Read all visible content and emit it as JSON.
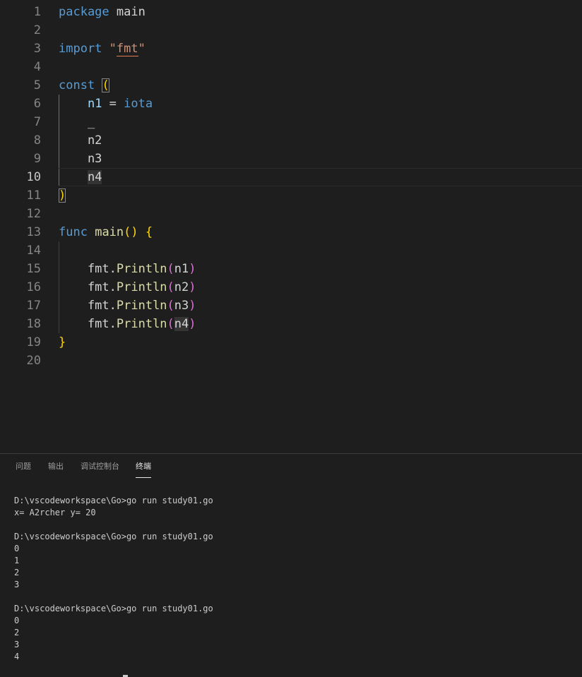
{
  "editor": {
    "lines": [
      {
        "n": "1",
        "tokens": [
          {
            "t": "package",
            "c": "kw"
          },
          {
            "t": " main",
            "c": "txt"
          }
        ]
      },
      {
        "n": "2",
        "tokens": []
      },
      {
        "n": "3",
        "tokens": [
          {
            "t": "import",
            "c": "kw"
          },
          {
            "t": " ",
            "c": "txt"
          },
          {
            "t": "\"",
            "c": "str"
          },
          {
            "t": "fmt",
            "c": "str",
            "squiggle": true
          },
          {
            "t": "\"",
            "c": "str"
          }
        ]
      },
      {
        "n": "4",
        "tokens": []
      },
      {
        "n": "5",
        "tokens": [
          {
            "t": "const",
            "c": "kw"
          },
          {
            "t": " ",
            "c": "txt"
          },
          {
            "t": "(",
            "c": "b1",
            "match": true
          }
        ]
      },
      {
        "n": "6",
        "tokens": [
          {
            "t": "    ",
            "c": "txt"
          },
          {
            "t": "n1",
            "c": "const"
          },
          {
            "t": " = ",
            "c": "txt"
          },
          {
            "t": "iota",
            "c": "kw"
          }
        ]
      },
      {
        "n": "7",
        "tokens": [
          {
            "t": "    _",
            "c": "txt"
          }
        ]
      },
      {
        "n": "8",
        "tokens": [
          {
            "t": "    n2",
            "c": "txt"
          }
        ]
      },
      {
        "n": "9",
        "tokens": [
          {
            "t": "    n3",
            "c": "txt"
          }
        ]
      },
      {
        "n": "10",
        "tokens": [
          {
            "t": "    ",
            "c": "txt"
          },
          {
            "t": "n4",
            "c": "txt",
            "hl": true
          }
        ],
        "current": true
      },
      {
        "n": "11",
        "tokens": [
          {
            "t": ")",
            "c": "b1",
            "match": true
          }
        ]
      },
      {
        "n": "12",
        "tokens": []
      },
      {
        "n": "13",
        "tokens": [
          {
            "t": "func",
            "c": "kw"
          },
          {
            "t": " ",
            "c": "txt"
          },
          {
            "t": "main",
            "c": "fn"
          },
          {
            "t": "()",
            "c": "b1"
          },
          {
            "t": " ",
            "c": "txt"
          },
          {
            "t": "{",
            "c": "b1"
          }
        ]
      },
      {
        "n": "14",
        "tokens": []
      },
      {
        "n": "15",
        "tokens": [
          {
            "t": "    fmt.",
            "c": "txt"
          },
          {
            "t": "Println",
            "c": "fn"
          },
          {
            "t": "(",
            "c": "b2"
          },
          {
            "t": "n1",
            "c": "txt"
          },
          {
            "t": ")",
            "c": "b2"
          }
        ]
      },
      {
        "n": "16",
        "tokens": [
          {
            "t": "    fmt.",
            "c": "txt"
          },
          {
            "t": "Println",
            "c": "fn"
          },
          {
            "t": "(",
            "c": "b2"
          },
          {
            "t": "n2",
            "c": "txt"
          },
          {
            "t": ")",
            "c": "b2"
          }
        ]
      },
      {
        "n": "17",
        "tokens": [
          {
            "t": "    fmt.",
            "c": "txt"
          },
          {
            "t": "Println",
            "c": "fn"
          },
          {
            "t": "(",
            "c": "b2"
          },
          {
            "t": "n3",
            "c": "txt"
          },
          {
            "t": ")",
            "c": "b2"
          }
        ]
      },
      {
        "n": "18",
        "tokens": [
          {
            "t": "    fmt.",
            "c": "txt"
          },
          {
            "t": "Println",
            "c": "fn"
          },
          {
            "t": "(",
            "c": "b2"
          },
          {
            "t": "n4",
            "c": "txt",
            "hl": true
          },
          {
            "t": ")",
            "c": "b2"
          }
        ]
      },
      {
        "n": "19",
        "tokens": [
          {
            "t": "}",
            "c": "b1"
          }
        ]
      },
      {
        "n": "20",
        "tokens": []
      }
    ]
  },
  "panel": {
    "tabs": [
      {
        "label": "问题",
        "name": "tab-problems",
        "active": false
      },
      {
        "label": "输出",
        "name": "tab-output",
        "active": false
      },
      {
        "label": "调试控制台",
        "name": "tab-debug-console",
        "active": false
      },
      {
        "label": "终端",
        "name": "tab-terminal",
        "active": true
      }
    ]
  },
  "terminal": {
    "lines": [
      "D:\\vscodeworkspace\\Go>go run study01.go",
      "x= A2rcher y= 20",
      "",
      "D:\\vscodeworkspace\\Go>go run study01.go",
      "0",
      "1",
      "2",
      "3",
      "",
      "D:\\vscodeworkspace\\Go>go run study01.go",
      "0",
      "2",
      "3",
      "4"
    ]
  },
  "colors": {
    "background": "#1e1e1e",
    "keyword": "#569cd6",
    "string": "#ce9178",
    "function": "#dcdcaa",
    "bracket_level1": "#ffd700",
    "bracket_level2": "#da70d6",
    "constant": "#9cdcfe",
    "text": "#d4d4d4"
  }
}
